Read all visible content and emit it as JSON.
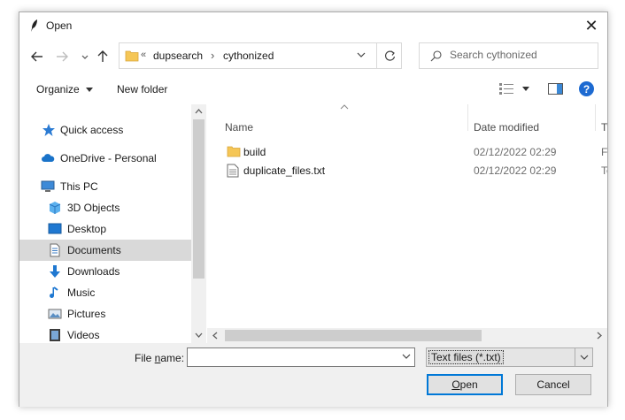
{
  "window": {
    "title": "Open",
    "close_glyph": "✕"
  },
  "address": {
    "overflow_glyph": "«",
    "crumbs": [
      "dupsearch",
      "cythonized"
    ],
    "separator": "›"
  },
  "search": {
    "placeholder": "Search cythonized"
  },
  "toolbar": {
    "organize_label": "Organize",
    "new_folder_label": "New folder"
  },
  "nav_pane": {
    "items": [
      {
        "label": "Quick access",
        "icon": "star-icon"
      },
      {
        "label": "OneDrive - Personal",
        "icon": "cloud-icon"
      },
      {
        "label": "This PC",
        "icon": "computer-icon"
      },
      {
        "label": "3D Objects",
        "icon": "cube-icon"
      },
      {
        "label": "Desktop",
        "icon": "desktop-icon"
      },
      {
        "label": "Documents",
        "icon": "document-icon",
        "selected": true
      },
      {
        "label": "Downloads",
        "icon": "download-icon"
      },
      {
        "label": "Music",
        "icon": "music-icon"
      },
      {
        "label": "Pictures",
        "icon": "picture-icon"
      },
      {
        "label": "Videos",
        "icon": "video-icon"
      }
    ]
  },
  "file_list": {
    "columns": {
      "name": "Name",
      "date_modified": "Date modified",
      "type": "Ty"
    },
    "rows": [
      {
        "name": "build",
        "date": "02/12/2022 02:29",
        "type": "Fi",
        "icon": "folder-icon"
      },
      {
        "name": "duplicate_files.txt",
        "date": "02/12/2022 02:29",
        "type": "Te",
        "icon": "text-file-icon"
      }
    ]
  },
  "footer": {
    "file_name_label_prefix": "File ",
    "file_name_label_underlined": "n",
    "file_name_label_suffix": "ame:",
    "file_name_value": "",
    "file_type_value": "Text files (*.txt)",
    "open_label_underlined": "O",
    "open_label_rest": "pen",
    "cancel_label": "Cancel"
  },
  "colors": {
    "accent": "#0078d7",
    "folder": "#f5c656",
    "help": "#1d6ad1",
    "selection": "#d9d9d9"
  }
}
